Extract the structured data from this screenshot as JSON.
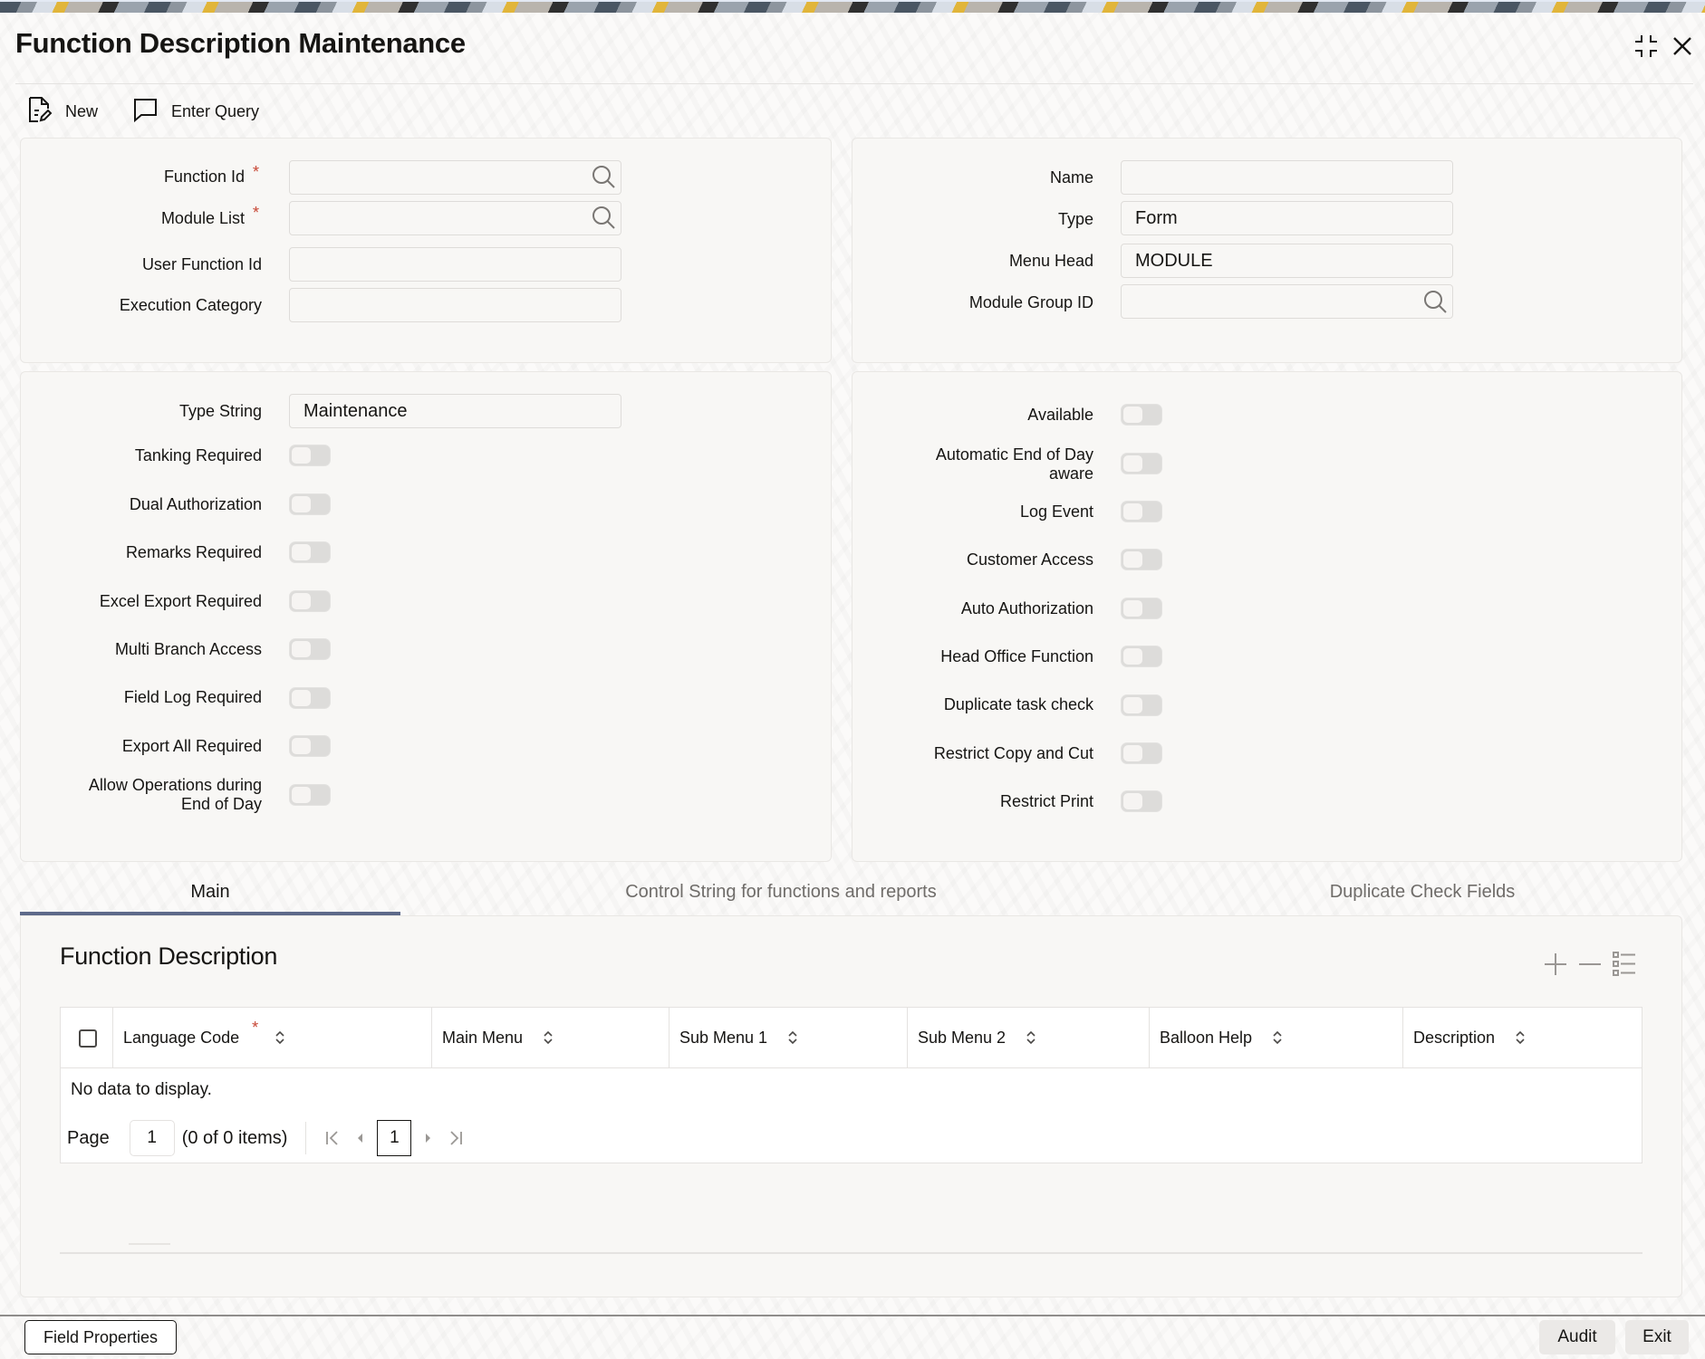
{
  "window": {
    "title": "Function Description Maintenance",
    "minimize_icon": "collapse-icon",
    "close_icon": "close-icon"
  },
  "toolbar": {
    "new_label": "New",
    "enter_query_label": "Enter Query"
  },
  "header_left": {
    "function_id": {
      "label": "Function Id",
      "required": true,
      "value": ""
    },
    "module_list": {
      "label": "Module List",
      "required": true,
      "value": ""
    },
    "user_function_id": {
      "label": "User Function Id",
      "value": ""
    },
    "execution_category": {
      "label": "Execution Category",
      "value": ""
    }
  },
  "header_right": {
    "name": {
      "label": "Name",
      "value": ""
    },
    "type": {
      "label": "Type",
      "value": "Form"
    },
    "menu_head": {
      "label": "Menu Head",
      "value": "MODULE"
    },
    "module_group_id": {
      "label": "Module Group ID",
      "value": ""
    }
  },
  "options_left": {
    "type_string": {
      "label": "Type String",
      "value": "Maintenance"
    },
    "toggles": [
      {
        "label": "Tanking Required",
        "on": false
      },
      {
        "label": "Dual Authorization",
        "on": false
      },
      {
        "label": "Remarks Required",
        "on": false
      },
      {
        "label": "Excel Export Required",
        "on": false
      },
      {
        "label": "Multi Branch Access",
        "on": false
      },
      {
        "label": "Field Log Required",
        "on": false
      },
      {
        "label": "Export All Required",
        "on": false
      },
      {
        "label_line1": "Allow Operations during",
        "label_line2": "End of Day",
        "on": false
      }
    ]
  },
  "options_right": {
    "toggles": [
      {
        "label": "Available",
        "on": false
      },
      {
        "label_line1": "Automatic End of Day",
        "label_line2": "aware",
        "on": false
      },
      {
        "label": "Log Event",
        "on": false
      },
      {
        "label": "Customer Access",
        "on": false
      },
      {
        "label": "Auto Authorization",
        "on": false
      },
      {
        "label": "Head Office Function",
        "on": false
      },
      {
        "label": "Duplicate task check",
        "on": false
      },
      {
        "label": "Restrict Copy and Cut",
        "on": false
      },
      {
        "label": "Restrict Print",
        "on": false
      }
    ]
  },
  "tabs": [
    {
      "label": "Main",
      "active": true
    },
    {
      "label": "Control String for functions and reports",
      "active": false
    },
    {
      "label": "Duplicate Check Fields",
      "active": false
    }
  ],
  "function_description": {
    "title": "Function Description",
    "columns": [
      {
        "label": "Language Code",
        "required": true
      },
      {
        "label": "Main Menu"
      },
      {
        "label": "Sub Menu 1"
      },
      {
        "label": "Sub Menu 2"
      },
      {
        "label": "Balloon Help"
      },
      {
        "label": "Description"
      }
    ],
    "rows": [],
    "empty_text": "No data to display.",
    "pagination": {
      "page_label": "Page",
      "page_value": "1",
      "summary": "(0 of 0 items)",
      "current_page": "1"
    }
  },
  "footer": {
    "field_properties_label": "Field Properties",
    "audit_label": "Audit",
    "exit_label": "Exit"
  },
  "colors": {
    "accent_tab": "#5e6a8a",
    "required": "#c74634"
  }
}
